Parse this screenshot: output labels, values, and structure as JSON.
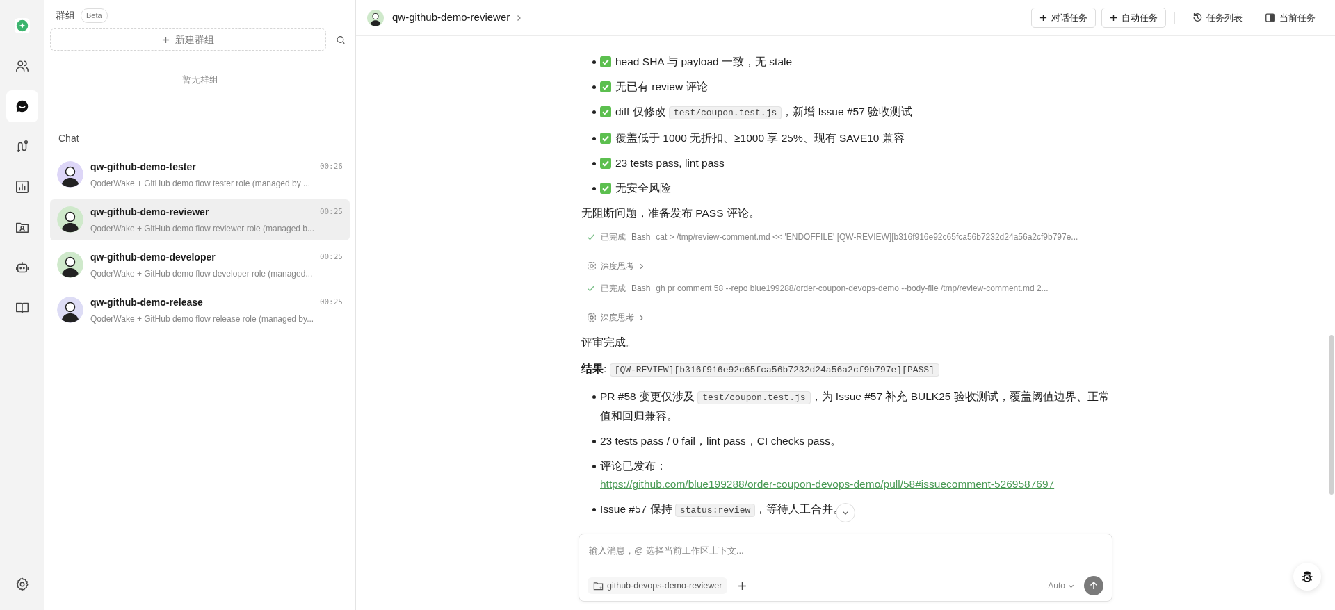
{
  "rail": {
    "items": [
      {
        "kind": "logo",
        "selected": false
      },
      {
        "kind": "people",
        "selected": false
      },
      {
        "kind": "chat",
        "selected": true
      },
      {
        "kind": "flow",
        "selected": false
      },
      {
        "kind": "chart",
        "selected": false
      },
      {
        "kind": "folder",
        "selected": false
      },
      {
        "kind": "robot",
        "selected": false
      },
      {
        "kind": "book",
        "selected": false
      }
    ]
  },
  "groups": {
    "title": "群组",
    "badge": "Beta",
    "new_button": "新建群组",
    "empty": "暂无群组"
  },
  "chat": {
    "title": "Chat",
    "items": [
      {
        "name": "qw-github-demo-tester",
        "time": "00:26",
        "preview": "QoderWake + GitHub demo flow tester role (managed by ...",
        "selected": false,
        "color": "#ddd6f7"
      },
      {
        "name": "qw-github-demo-reviewer",
        "time": "00:25",
        "preview": "QoderWake + GitHub demo flow reviewer role (managed b...",
        "selected": true,
        "color": "#cfe9cb"
      },
      {
        "name": "qw-github-demo-developer",
        "time": "00:25",
        "preview": "QoderWake + GitHub demo flow developer role (managed...",
        "selected": false,
        "color": "#cfe9cb"
      },
      {
        "name": "qw-github-demo-release",
        "time": "00:25",
        "preview": "QoderWake + GitHub demo flow release role (managed by...",
        "selected": false,
        "color": "#dddcf5"
      }
    ]
  },
  "header": {
    "title": "qw-github-demo-reviewer",
    "buttons": [
      "对话任务",
      "自动任务"
    ],
    "links": [
      {
        "kind": "history",
        "label": "任务列表"
      },
      {
        "kind": "panel",
        "label": "当前任务"
      }
    ]
  },
  "messages": [
    {
      "kind": "checklist",
      "items": [
        [
          {
            "kind": "text",
            "text": "head SHA 与 payload 一致，无 stale"
          }
        ],
        [
          {
            "kind": "text",
            "text": "无已有 review 评论"
          }
        ],
        [
          {
            "kind": "text",
            "text": "diff 仅修改 "
          },
          {
            "kind": "code",
            "text": "test/coupon.test.js"
          },
          {
            "kind": "text",
            "text": "，新增 Issue #57 验收测试"
          }
        ],
        [
          {
            "kind": "text",
            "text": "覆盖低于 1000 无折扣、≥1000 享 25%、现有 SAVE10 兼容"
          }
        ],
        [
          {
            "kind": "text",
            "text": "23 tests pass, lint pass"
          }
        ],
        [
          {
            "kind": "text",
            "text": "无安全风险"
          }
        ]
      ]
    },
    {
      "kind": "paragraph",
      "segments": [
        {
          "kind": "text",
          "text": "无阻断问题，准备发布 PASS 评论。"
        }
      ]
    },
    {
      "kind": "tool",
      "status": "已完成",
      "tool": "Bash",
      "command": "cat > /tmp/review-comment.md << 'ENDOFFILE' [QW-REVIEW][b316f916e92c65fca56b7232d24a56a2cf9b797e..."
    },
    {
      "kind": "thinking",
      "label": "深度思考"
    },
    {
      "kind": "tool",
      "status": "已完成",
      "tool": "Bash",
      "command": "gh pr comment 58 --repo blue199288/order-coupon-devops-demo --body-file /tmp/review-comment.md 2..."
    },
    {
      "kind": "thinking",
      "label": "深度思考"
    },
    {
      "kind": "paragraph",
      "segments": [
        {
          "kind": "text",
          "text": "评审完成。"
        }
      ]
    },
    {
      "kind": "paragraph",
      "segments": [
        {
          "kind": "bold",
          "text": "结果"
        },
        {
          "kind": "text",
          "text": ": "
        },
        {
          "kind": "code",
          "text": "[QW-REVIEW][b316f916e92c65fca56b7232d24a56a2cf9b797e][PASS]"
        }
      ]
    },
    {
      "kind": "bullets",
      "items": [
        [
          {
            "kind": "text",
            "text": "PR #58 变更仅涉及 "
          },
          {
            "kind": "code",
            "text": "test/coupon.test.js"
          },
          {
            "kind": "text",
            "text": "，为 Issue #57 补充 BULK25 验收测试，覆盖阈值边界、正常值和回归兼容。"
          }
        ],
        [
          {
            "kind": "text",
            "text": "23 tests pass / 0 fail，lint pass，CI checks pass。"
          }
        ],
        [
          {
            "kind": "text",
            "text": "评论已发布："
          },
          {
            "kind": "link",
            "text": "https://github.com/blue199288/order-coupon-devops-demo/pull/58#issuecomment-5269587697"
          }
        ],
        [
          {
            "kind": "text",
            "text": "Issue #57 保持 "
          },
          {
            "kind": "code",
            "text": "status:review"
          },
          {
            "kind": "text",
            "text": "，等待人工合并。"
          }
        ]
      ]
    }
  ],
  "composer": {
    "placeholder": "输入消息，@ 选择当前工作区上下文...",
    "workspace": "github-devops-demo-reviewer",
    "model": "Auto"
  }
}
